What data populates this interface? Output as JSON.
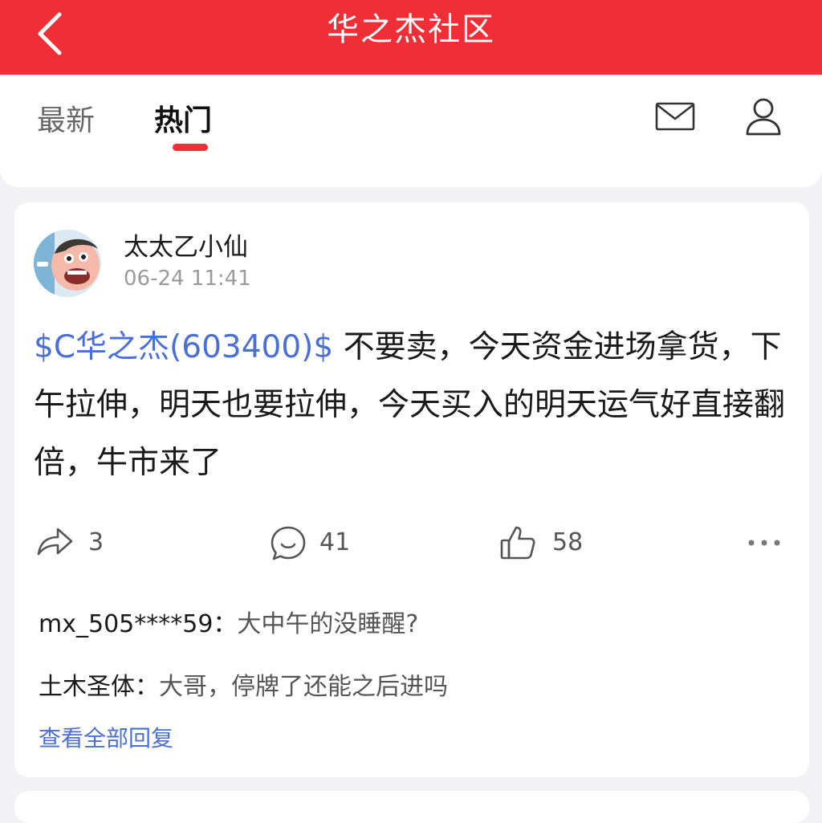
{
  "header": {
    "title": "华之杰社区",
    "back_icon": "chevron-left-icon",
    "background_color": "#ef2f35"
  },
  "tabs": {
    "items": [
      {
        "label": "最新",
        "active": false
      },
      {
        "label": "热门",
        "active": true
      }
    ],
    "accent_color": "#ef2f35",
    "right_icons": [
      "mail-icon",
      "user-icon"
    ]
  },
  "post": {
    "username": "太太乙小仙",
    "time": "06-24 11:41",
    "stock_tag": "$C华之杰(603400)$",
    "content": " 不要卖，今天资金进场拿货，下午拉伸，明天也要拉伸，今天买入的明天运气好直接翻倍，牛市来了",
    "shares": "3",
    "comments": "41",
    "likes": "58",
    "link_color": "#4a6fd8"
  },
  "replies": [
    {
      "author": "mx_505****59：",
      "text": "大中午的没睡醒?"
    },
    {
      "author": "土木圣体：",
      "text": "大哥，停牌了还能之后进吗"
    }
  ],
  "view_all_label": "查看全部回复"
}
